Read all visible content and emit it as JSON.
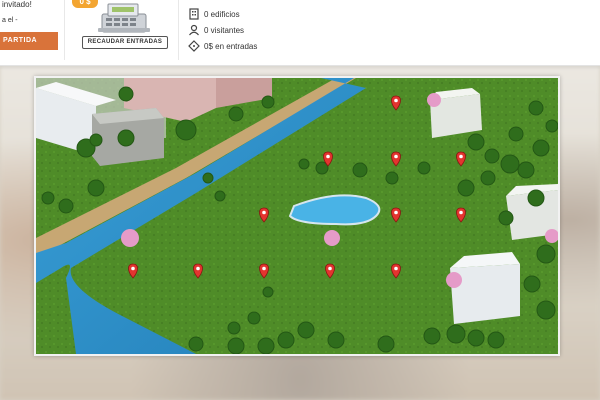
{
  "header": {
    "guest_greeting": "invitado!",
    "small_text": "a el -",
    "start_button_label": "PARTIDA",
    "coin_badge": "0 $",
    "collect_button_label": "RECAUDAR ENTRADAS",
    "stats": [
      {
        "icon": "building-icon",
        "text": "0 edificios"
      },
      {
        "icon": "person-icon",
        "text": "0 visitantes"
      },
      {
        "icon": "ticket-icon",
        "text": "0$ en entradas"
      }
    ]
  },
  "map": {
    "pins": [
      {
        "row": 1,
        "col": 1
      },
      {
        "row": 2,
        "col": 1
      },
      {
        "row": 2,
        "col": 2
      },
      {
        "row": 2,
        "col": 3
      },
      {
        "row": 3,
        "col": 1
      },
      {
        "row": 3,
        "col": 2
      },
      {
        "row": 3,
        "col": 3
      },
      {
        "row": 4,
        "col": 1
      },
      {
        "row": 4,
        "col": 2
      },
      {
        "row": 4,
        "col": 3
      },
      {
        "row": 4,
        "col": 4
      },
      {
        "row": 4,
        "col": 5
      }
    ],
    "colors": {
      "grass": "#4d8a26",
      "river": "#2e8ec9",
      "pin": "#e3342f",
      "accent": "#d9733a"
    }
  }
}
